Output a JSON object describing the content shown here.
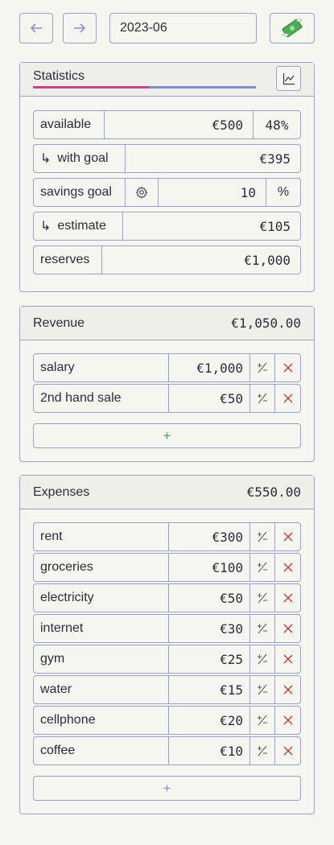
{
  "toolbar": {
    "month_value": "2023-06",
    "prev_icon": "arrow-left-icon",
    "next_icon": "arrow-right-icon",
    "money_icon": "money-with-wings-icon"
  },
  "statistics": {
    "title": "Statistics",
    "progress_fraction": 0.52,
    "progress_color": "#c9408e",
    "progress_track_color": "#7e8ed3",
    "rows": {
      "available": {
        "label": "available",
        "value": "€500",
        "percent": "48%"
      },
      "with_goal": {
        "label": "with goal",
        "value": "€395"
      },
      "savings_goal": {
        "label": "savings goal",
        "value": "10",
        "unit": "%"
      },
      "estimate": {
        "label": "estimate",
        "value": "€105"
      },
      "reserves": {
        "label": "reserves",
        "value": "€1,000"
      }
    }
  },
  "revenue": {
    "title": "Revenue",
    "total": "€1,050.00",
    "items": [
      {
        "name": "salary",
        "amount": "€1,000"
      },
      {
        "name": "2nd hand sale",
        "amount": "€50"
      }
    ],
    "add_label": "+"
  },
  "expenses": {
    "title": "Expenses",
    "total": "€550.00",
    "items": [
      {
        "name": "rent",
        "amount": "€300"
      },
      {
        "name": "groceries",
        "amount": "€100"
      },
      {
        "name": "electricity",
        "amount": "€50"
      },
      {
        "name": "internet",
        "amount": "€30"
      },
      {
        "name": "gym",
        "amount": "€25"
      },
      {
        "name": "water",
        "amount": "€15"
      },
      {
        "name": "cellphone",
        "amount": "€20"
      },
      {
        "name": "coffee",
        "amount": "€10"
      }
    ],
    "add_label": "+"
  },
  "colors": {
    "accent": "#8a8fd0",
    "delete": "#d0353f",
    "add_revenue": "#3fa14a",
    "add_expense": "#8a8fd0"
  }
}
